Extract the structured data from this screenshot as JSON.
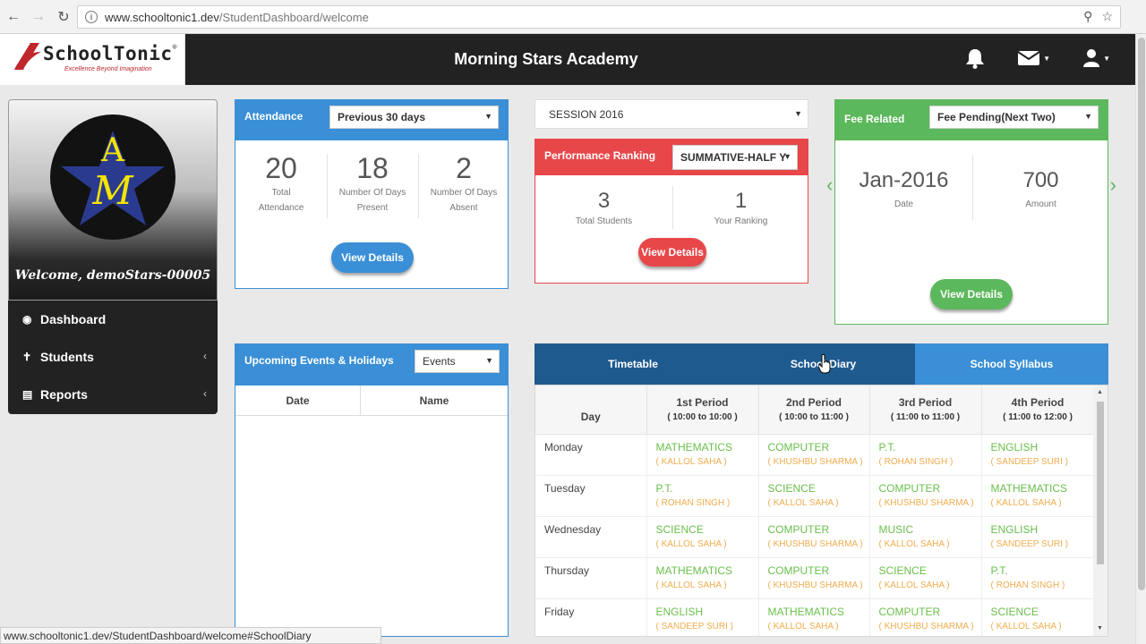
{
  "browser": {
    "url_host": "www.schooltonic1.dev",
    "url_path": "/StudentDashboard/welcome",
    "status_url": "www.schooltonic1.dev/StudentDashboard/welcome#SchoolDiary"
  },
  "header": {
    "logo_text": "SchoolTonic",
    "logo_reg": "®",
    "logo_tagline": "Excellence Beyond Imagination",
    "school_name": "Morning Stars Academy"
  },
  "profile": {
    "welcome": "Welcome, demoStars-00005",
    "avatar_letters": [
      "A",
      "M"
    ]
  },
  "sidebar": {
    "items": [
      {
        "label": "Dashboard",
        "icon": "dashboard-icon"
      },
      {
        "label": "Students",
        "icon": "student-icon"
      },
      {
        "label": "Reports",
        "icon": "bar-chart-icon"
      }
    ]
  },
  "attendance": {
    "title": "Attendance",
    "period": "Previous 30 days",
    "stats": [
      {
        "value": "20",
        "label1": "Total",
        "label2": "Attendance"
      },
      {
        "value": "18",
        "label1": "Number Of Days",
        "label2": "Present"
      },
      {
        "value": "2",
        "label1": "Number Of Days",
        "label2": "Absent"
      }
    ],
    "button": "View Details"
  },
  "session": {
    "value": "SESSION 2016"
  },
  "performance": {
    "title": "Performance Ranking",
    "exam": "SUMMATIVE-HALF Y",
    "stats": [
      {
        "value": "3",
        "label": "Total Students"
      },
      {
        "value": "1",
        "label": "Your Ranking"
      }
    ],
    "button": "View Details"
  },
  "fee": {
    "title": "Fee Related",
    "filter": "Fee Pending(Next Two)",
    "stats": [
      {
        "value": "Jan-2016",
        "label": "Date"
      },
      {
        "value": "700",
        "label": "Amount"
      }
    ],
    "button": "View Details"
  },
  "events": {
    "title": "Upcoming Events & Holidays",
    "filter": "Events",
    "columns": [
      "Date",
      "Name"
    ]
  },
  "timetable": {
    "tabs": [
      "Timetable",
      "School Diary",
      "School Syllabus"
    ],
    "day_header": "Day",
    "periods": [
      {
        "name": "1st Period",
        "time": "( 10:00 to 10:00 )"
      },
      {
        "name": "2nd Period",
        "time": "( 10:00 to 11:00 )"
      },
      {
        "name": "3rd Period",
        "time": "( 11:00 to 11:00 )"
      },
      {
        "name": "4th Period",
        "time": "( 11:00 to 12:00 )"
      }
    ],
    "rows": [
      {
        "day": "Monday",
        "cells": [
          {
            "subject": "MATHEMATICS",
            "teacher": "( KALLOL SAHA )"
          },
          {
            "subject": "COMPUTER",
            "teacher": "( KHUSHBU SHARMA )"
          },
          {
            "subject": "P.T.",
            "teacher": "( ROHAN SINGH )"
          },
          {
            "subject": "ENGLISH",
            "teacher": "( SANDEEP SURI )"
          }
        ]
      },
      {
        "day": "Tuesday",
        "cells": [
          {
            "subject": "P.T.",
            "teacher": "( ROHAN SINGH )"
          },
          {
            "subject": "SCIENCE",
            "teacher": "( KALLOL SAHA )"
          },
          {
            "subject": "COMPUTER",
            "teacher": "( KHUSHBU SHARMA )"
          },
          {
            "subject": "MATHEMATICS",
            "teacher": "( KALLOL SAHA )"
          }
        ]
      },
      {
        "day": "Wednesday",
        "cells": [
          {
            "subject": "SCIENCE",
            "teacher": "( KALLOL SAHA )"
          },
          {
            "subject": "COMPUTER",
            "teacher": "( KHUSHBU SHARMA )"
          },
          {
            "subject": "MUSIC",
            "teacher": "( KALLOL SAHA )"
          },
          {
            "subject": "ENGLISH",
            "teacher": "( SANDEEP SURI )"
          }
        ]
      },
      {
        "day": "Thursday",
        "cells": [
          {
            "subject": "MATHEMATICS",
            "teacher": "( KALLOL SAHA )"
          },
          {
            "subject": "COMPUTER",
            "teacher": "( KHUSHBU SHARMA )"
          },
          {
            "subject": "SCIENCE",
            "teacher": "( KALLOL SAHA )"
          },
          {
            "subject": "P.T.",
            "teacher": "( ROHAN SINGH )"
          }
        ]
      },
      {
        "day": "Friday",
        "cells": [
          {
            "subject": "ENGLISH",
            "teacher": "( SANDEEP SURI )"
          },
          {
            "subject": "MATHEMATICS",
            "teacher": "( KALLOL SAHA )"
          },
          {
            "subject": "COMPUTER",
            "teacher": "( KHUSHBU SHARMA )"
          },
          {
            "subject": "SCIENCE",
            "teacher": "( KALLOL SAHA )"
          }
        ]
      }
    ]
  },
  "colors": {
    "blue": "#3a8fd6",
    "dark_blue": "#1f5a8f",
    "red": "#e8474a",
    "green": "#5cb85c",
    "header_bg": "#222222",
    "subject_green": "#6abf4b",
    "teacher_orange": "#f0ad4e"
  }
}
